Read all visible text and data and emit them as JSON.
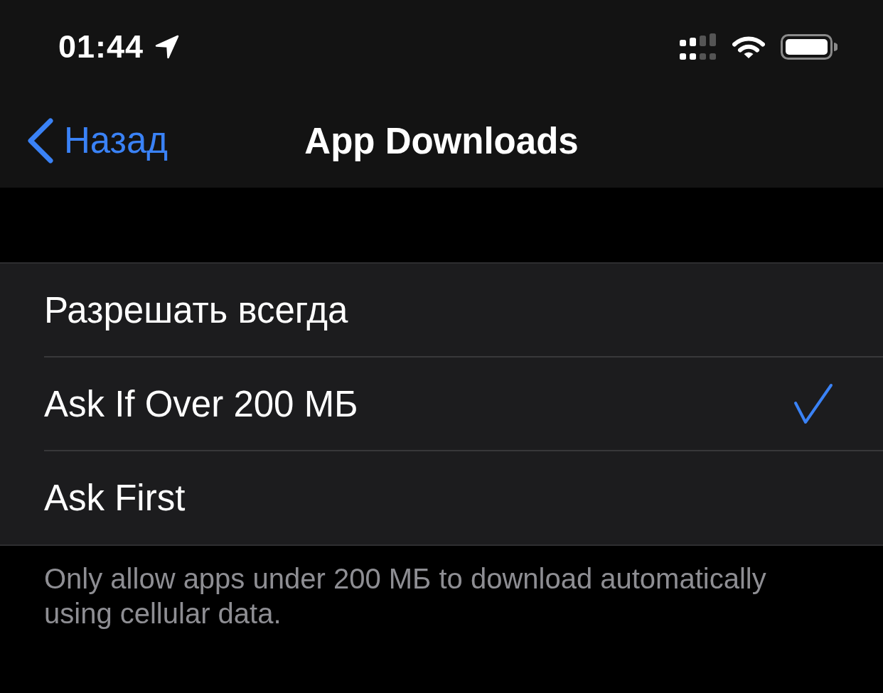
{
  "status_bar": {
    "time": "01:44"
  },
  "nav_bar": {
    "back_label": "Назад",
    "title": "App Downloads"
  },
  "options": [
    {
      "label": "Разрешать всегда",
      "selected": false
    },
    {
      "label": "Ask If Over 200 МБ",
      "selected": true
    },
    {
      "label": "Ask First",
      "selected": false
    }
  ],
  "footer": "Only allow apps under 200 МБ to download automatically using cellular data."
}
